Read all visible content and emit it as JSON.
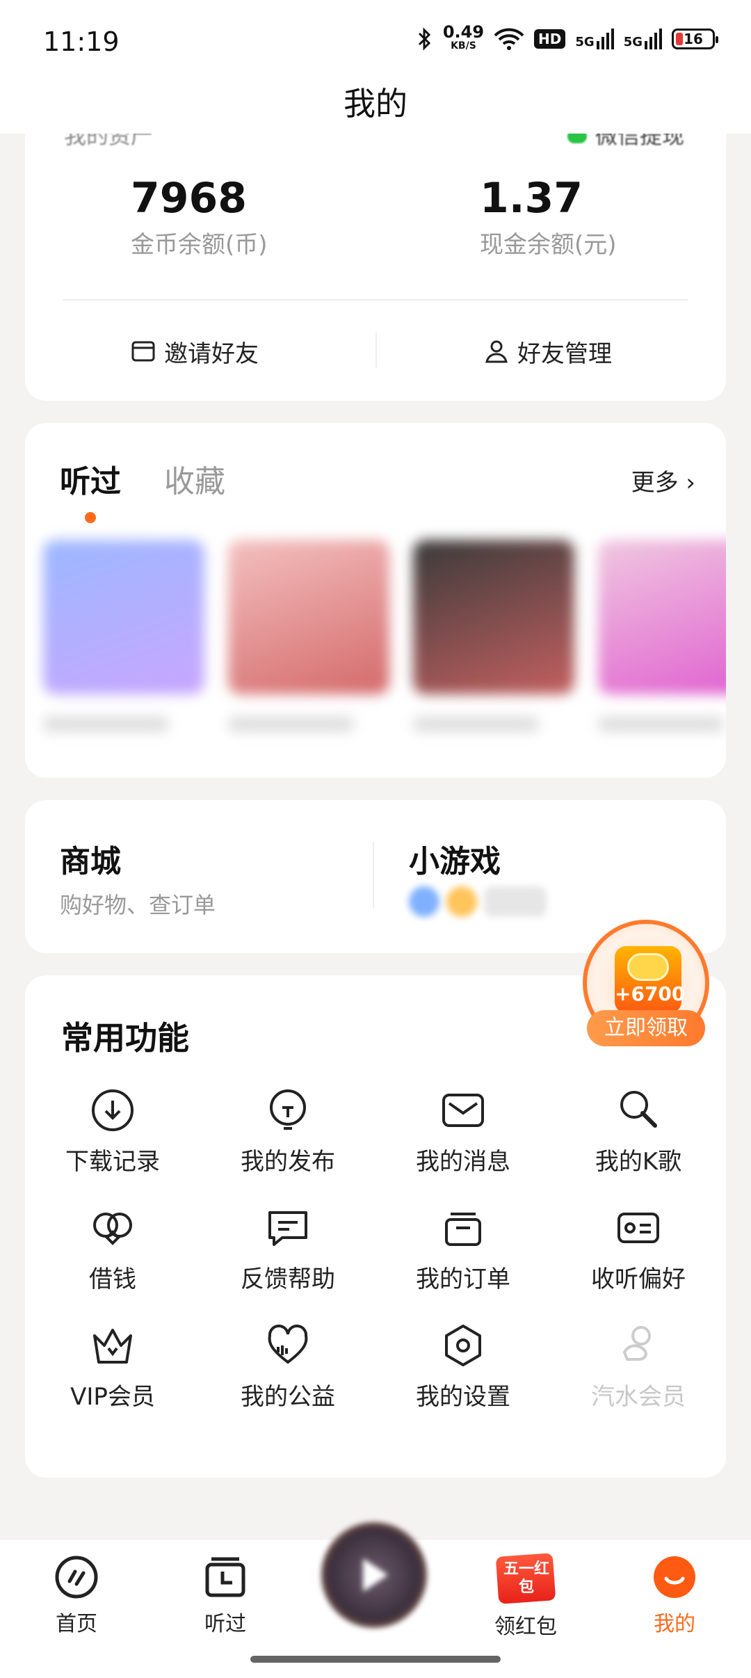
{
  "status_bar": {
    "time": "11:19",
    "speed_value": "0.49",
    "speed_unit": "KB/S",
    "hd": "HD",
    "net1": "5G",
    "net2": "5G",
    "battery": "16"
  },
  "header": {
    "title": "我的"
  },
  "assets": {
    "coin_value": "7968",
    "coin_label": "金币余额(币)",
    "cash_value": "1.37",
    "cash_label": "现金余额(元)",
    "invite_label": "邀请好友",
    "manage_label": "好友管理"
  },
  "history": {
    "tabs": [
      {
        "label": "听过"
      },
      {
        "label": "收藏"
      }
    ],
    "more_label": "更多",
    "covers": [
      {
        "colors": [
          "#9db8ff",
          "#c8a6ff"
        ]
      },
      {
        "colors": [
          "#f4c0c0",
          "#d46a6a"
        ]
      },
      {
        "colors": [
          "#3a3a3a",
          "#c46060"
        ]
      },
      {
        "colors": [
          "#f0c8e0",
          "#e060d0"
        ]
      }
    ]
  },
  "mall": {
    "title": "商城",
    "subtitle": "购好物、查订单",
    "games_title": "小游戏"
  },
  "common": {
    "title": "常用功能",
    "items": [
      {
        "label": "下载记录",
        "icon": "download-icon"
      },
      {
        "label": "我的发布",
        "icon": "publish-icon"
      },
      {
        "label": "我的消息",
        "icon": "message-icon"
      },
      {
        "label": "我的K歌",
        "icon": "karaoke-icon"
      },
      {
        "label": "借钱",
        "icon": "loan-icon"
      },
      {
        "label": "反馈帮助",
        "icon": "feedback-icon"
      },
      {
        "label": "我的订单",
        "icon": "order-icon"
      },
      {
        "label": "收听偏好",
        "icon": "preference-icon"
      },
      {
        "label": "VIP会员",
        "icon": "crown-icon"
      },
      {
        "label": "我的公益",
        "icon": "charity-icon"
      },
      {
        "label": "我的设置",
        "icon": "settings-icon"
      },
      {
        "label": "汽水会员",
        "icon": "soda-icon"
      }
    ]
  },
  "promo": {
    "amount": "+6700",
    "button": "立即领取"
  },
  "tabbar": {
    "home": "首页",
    "history": "听过",
    "redpack": "领红包",
    "redpack_badge": "五一红包",
    "me": "我的"
  },
  "colors": {
    "accent": "#ff6a1a",
    "background": "#f5f3f2",
    "card": "#ffffff"
  }
}
